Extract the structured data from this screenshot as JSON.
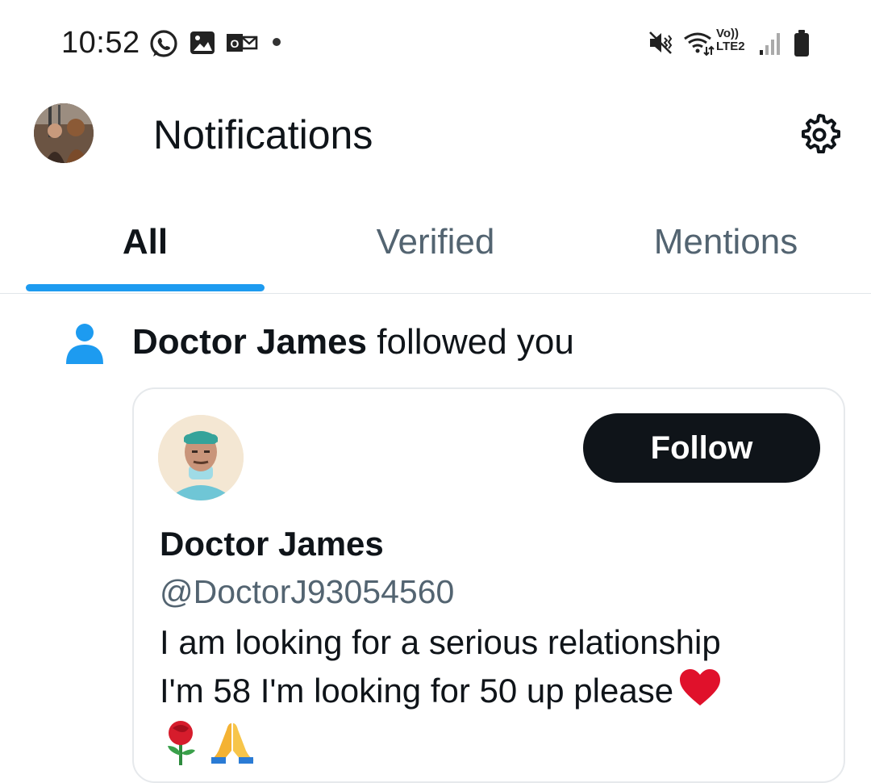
{
  "status_bar": {
    "time": "10:52",
    "network_label": "Vo))\nLTE2",
    "icons": [
      "whatsapp-icon",
      "gallery-icon",
      "outlook-icon",
      "notification-dot",
      "mute-icon",
      "wifi-icon",
      "signal-icon",
      "battery-icon"
    ]
  },
  "header": {
    "title": "Notifications"
  },
  "tabs": [
    {
      "label": "All",
      "active": true
    },
    {
      "label": "Verified",
      "active": false
    },
    {
      "label": "Mentions",
      "active": false
    }
  ],
  "notification": {
    "actor": "Doctor James",
    "action": "followed you",
    "card": {
      "name": "Doctor James",
      "handle": "@DoctorJ93054560",
      "bio_line1": "I am looking for a serious relationship",
      "bio_line2": "I'm 58 I'm looking for 50 up please",
      "follow_label": "Follow"
    }
  },
  "colors": {
    "accent": "#1d9bf0",
    "text_primary": "#0f1419",
    "text_secondary": "#536471",
    "button_bg": "#0f1419"
  }
}
